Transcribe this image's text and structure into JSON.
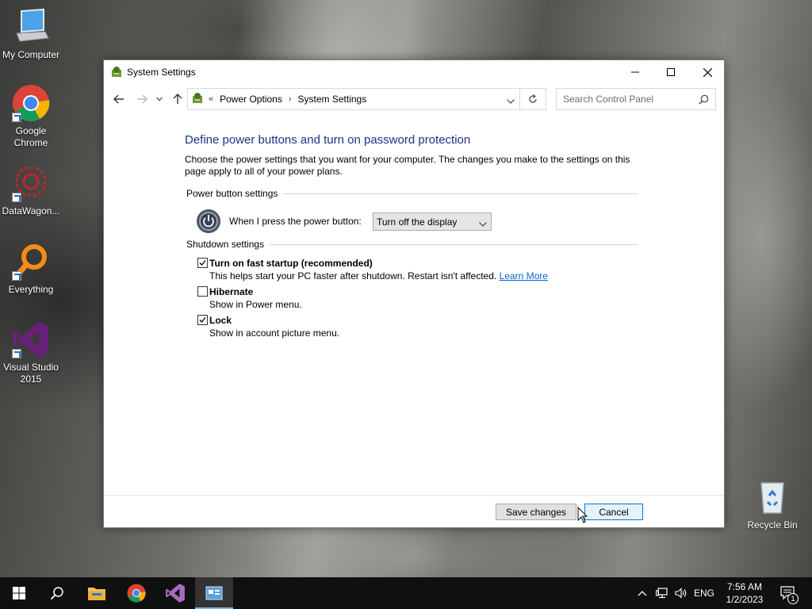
{
  "desktop": {
    "icons": [
      {
        "label": "My Computer"
      },
      {
        "label": "Google Chrome"
      },
      {
        "label": "DataWagon..."
      },
      {
        "label": "Everything"
      },
      {
        "label": "Visual Studio 2015"
      },
      {
        "label": "Recycle Bin"
      }
    ]
  },
  "window": {
    "title": "System Settings",
    "address": {
      "overflow": "«",
      "crumbs": [
        "Power Options",
        "System Settings"
      ]
    },
    "search": {
      "placeholder": "Search Control Panel"
    },
    "heading": "Define power buttons and turn on password protection",
    "intro": "Choose the power settings that you want for your computer. The changes you make to the settings on this page apply to all of your power plans.",
    "power_group": {
      "title": "Power button settings",
      "label": "When I press the power button:",
      "selected": "Turn off the display"
    },
    "shutdown_group": {
      "title": "Shutdown settings",
      "options": [
        {
          "title": "Turn on fast startup (recommended)",
          "desc": "This helps start your PC faster after shutdown. Restart isn't affected.",
          "link": "Learn More",
          "checked": true
        },
        {
          "title": "Hibernate",
          "desc": "Show in Power menu.",
          "checked": false
        },
        {
          "title": "Lock",
          "desc": "Show in account picture menu.",
          "checked": true
        }
      ]
    },
    "buttons": {
      "save": "Save changes",
      "cancel": "Cancel"
    }
  },
  "taskbar": {
    "language": "ENG",
    "time": "7:56 AM",
    "date": "1/2/2023",
    "notification_count": "1"
  },
  "colors": {
    "heading": "#1e3287",
    "link": "#0066cc",
    "accent": "#0078d7",
    "taskbar": "#101010"
  }
}
